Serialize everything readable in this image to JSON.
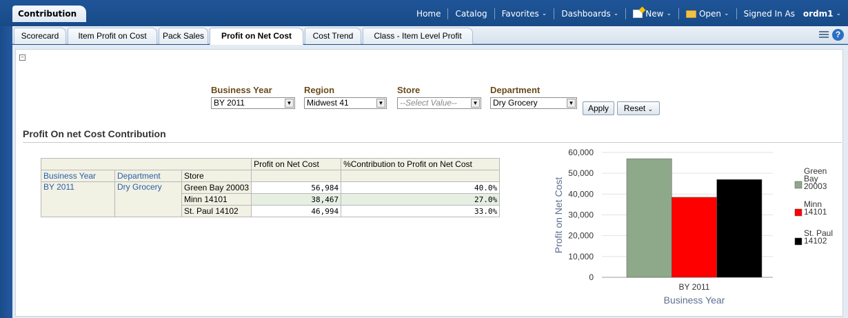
{
  "app_tab": "Contribution",
  "global_nav": {
    "home": "Home",
    "catalog": "Catalog",
    "favorites": "Favorites",
    "dashboards": "Dashboards",
    "new": "New",
    "open": "Open",
    "signed_in_prefix": "Signed In As",
    "user": "ordm1"
  },
  "tabs": [
    "Scorecard",
    "Item Profit on Cost",
    "Pack Sales",
    "Profit on Net Cost",
    "Cost Trend",
    "Class - Item Level Profit"
  ],
  "active_tab": "Profit on Net Cost",
  "prompts": {
    "business_year": {
      "label": "Business Year",
      "value": "BY 2011"
    },
    "region": {
      "label": "Region",
      "value": "Midwest 41"
    },
    "store": {
      "label": "Store",
      "value": "--Select Value--"
    },
    "department": {
      "label": "Department",
      "value": "Dry Grocery"
    },
    "apply": "Apply",
    "reset": "Reset"
  },
  "section_title": "Profit On net Cost Contribution",
  "table": {
    "measure_headers": [
      "Profit on Net Cost",
      "%Contribution to Profit on Net Cost"
    ],
    "dim_headers": [
      "Business Year",
      "Department",
      "Store"
    ],
    "business_year": "BY 2011",
    "department": "Dry Grocery",
    "rows": [
      {
        "store": "Green Bay 20003",
        "profit": "56,984",
        "pct": "40.0%"
      },
      {
        "store": "Minn 14101",
        "profit": "38,467",
        "pct": "27.0%"
      },
      {
        "store": "St. Paul 14102",
        "profit": "46,994",
        "pct": "33.0%"
      }
    ]
  },
  "colors": {
    "accent": "#1f5598",
    "green_bar": "#8ea88a",
    "red_bar": "#ff0000",
    "black_bar": "#000000"
  },
  "chart_data": {
    "type": "bar",
    "categories": [
      "BY 2011"
    ],
    "series": [
      {
        "name": "Green Bay 20003",
        "values": [
          56984
        ],
        "color": "#8ea88a"
      },
      {
        "name": "Minn 14101",
        "values": [
          38467
        ],
        "color": "#ff0000"
      },
      {
        "name": "St. Paul 14102",
        "values": [
          46994
        ],
        "color": "#000000"
      }
    ],
    "xlabel": "Business Year",
    "ylabel": "Profit on Net Cost",
    "ylim": [
      0,
      60000
    ],
    "yticks": [
      "0",
      "10,000",
      "20,000",
      "30,000",
      "40,000",
      "50,000",
      "60,000"
    ],
    "legend_position": "right",
    "legend_lines": [
      [
        "Green",
        "Bay",
        "20003"
      ],
      [
        "Minn",
        "14101"
      ],
      [
        "St. Paul",
        "14102"
      ]
    ]
  }
}
